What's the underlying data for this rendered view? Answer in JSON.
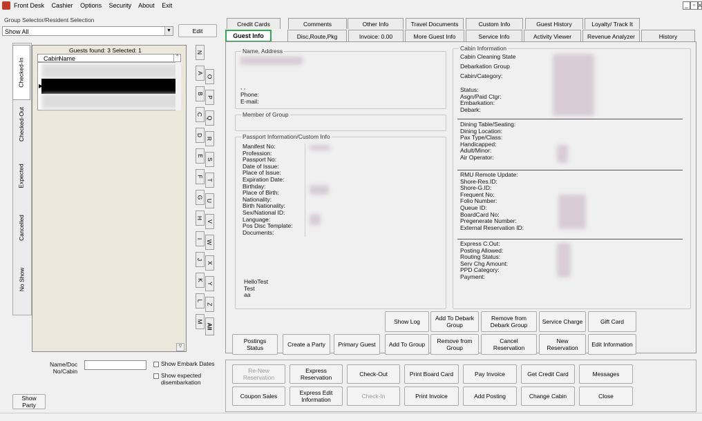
{
  "menu": [
    "Front Desk",
    "Cashier",
    "Options",
    "Security",
    "About",
    "Exit"
  ],
  "window_controls": [
    "_",
    "▫",
    "x"
  ],
  "group_selector": {
    "legend": "Group Selector/Resident Selection",
    "value": "Show All",
    "edit": "Edit"
  },
  "guest_list": {
    "found": "Guests found: 3 Selected: 1",
    "col_cabin": "Cabin",
    "col_name": "Name"
  },
  "side_tabs": [
    "Checked-In",
    "Checked-Out",
    "Expected",
    "Cancelled",
    "No Show"
  ],
  "letters": [
    "N",
    "O",
    "A",
    "P",
    "B",
    "Q",
    "C",
    "R",
    "D",
    "S",
    "E",
    "T",
    "F",
    "U",
    "G",
    "V",
    "H",
    "W",
    "I",
    "X",
    "J",
    "Y",
    "K",
    "Z",
    "L",
    "All",
    "M"
  ],
  "filter": {
    "name_label": "Name/Doc\nNo/Cabin",
    "show_embark": "Show Embark Dates",
    "show_expected": "Show expected\ndisembarkation",
    "show_party": "Show Party"
  },
  "tabs_top": [
    "Credit Cards",
    "Comments",
    "Other Info",
    "Travel Documents",
    "Custom Info",
    "Guest History",
    "Loyalty/ Track It"
  ],
  "tabs_bottom": [
    "Guest Info",
    "Disc,Route,Pkg",
    "Invoice: 0.00",
    "More Guest Info",
    "Service Info",
    "Activity Viewer",
    "Revenue Analyzer",
    "History"
  ],
  "name_address": {
    "legend": "Name, Address",
    "comma": ", ,",
    "phone": "Phone:",
    "email": "E-mail:"
  },
  "member_group": {
    "legend": "Member of Group"
  },
  "passport": {
    "legend": "Passport Information/Custom Info",
    "labels": "Manifest No:\nProfession:\nPassport No:\nDate of Issue:\nPlace of Issue:\nExpiration Date:\nBirthday:\nPlace of Birth:\nNationality:\nBirth Nationality:\nSex/National ID:\nLanguage:\nPos Disc Template:\nDocuments:",
    "notes": "HelloTest\nTest\naa"
  },
  "cabin": {
    "legend": "Cabin Information",
    "sec1": "Cabin Cleaning State",
    "sec1b": "Debarkation Group",
    "sec1c": "Cabin/Category:",
    "sec2": "Status:\nAsgn/Paid Ctgr:\nEmbarkation:\nDebark:",
    "sec3": "Dining Table/Seating:\nDining Location:\nPax Type/Class:\nHandicapped:\nAdult/Minor:\nAir Operator:",
    "sec4": "RMU Remote Update:\nShore-Res.ID:\nShore-G.ID:\nFrequent No:\nFolio Number:\nQueue ID:\nBoardCard No:\nPregenerate Number:\nExternal Reservation ID:",
    "sec5": "Express C.Out:\nPosting Allowed:\nRouting Status:\nServ Chg Amount:\nPPD Category:\nPayment:"
  },
  "actions_row1": [
    "Show Log",
    "Add To Debark Group",
    "Remove from Debark Group",
    "Service Charge",
    "Gift Card"
  ],
  "actions_row2": [
    "Postings Status",
    "Create a Party",
    "Primary Guest",
    "Add To Group",
    "Remove from Group",
    "Cancel Reservation",
    "New Reservation",
    "Edit Information"
  ],
  "bottom_row1": [
    "Re-New Reservation",
    "Express Reservation",
    "Check-Out",
    "Print Board Card",
    "Pay Invoice",
    "Get Credit Card",
    "Messages"
  ],
  "bottom_row2": [
    "Coupon Sales",
    "Express Edit Information",
    "Check-In",
    "Print Invoice",
    "Add Posting",
    "Change Cabin",
    "Close"
  ]
}
